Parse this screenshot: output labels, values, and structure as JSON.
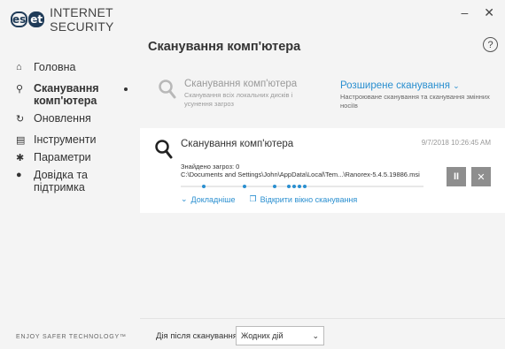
{
  "app": {
    "logo_part1": "es",
    "logo_part2": "et",
    "product_name": "INTERNET SECURITY",
    "tagline": "ENJOY SAFER TECHNOLOGY™"
  },
  "window_controls": {
    "minimize": "–",
    "close": "✕"
  },
  "help": {
    "label": "?"
  },
  "sidebar": {
    "items": [
      {
        "icon": "home-icon",
        "glyph": "⌂",
        "label": "Головна",
        "active": false
      },
      {
        "icon": "search-icon",
        "glyph": "⚲",
        "label": "Сканування комп'ютера",
        "active": true
      },
      {
        "icon": "refresh-icon",
        "glyph": "↻",
        "label": "Оновлення",
        "active": false
      },
      {
        "icon": "toolbox-icon",
        "glyph": "▤",
        "label": "Інструменти",
        "active": false
      },
      {
        "icon": "gear-icon",
        "glyph": "✱",
        "label": "Параметри",
        "active": false
      },
      {
        "icon": "info-icon",
        "glyph": "●",
        "label": "Довідка та підтримка",
        "active": false
      }
    ]
  },
  "main": {
    "title": "Сканування комп'ютера",
    "options": {
      "computer_scan": {
        "title": "Сканування комп'ютера",
        "subtitle": "Сканування всіх локальних дисків і усунення загроз"
      },
      "advanced_scan": {
        "title": "Розширене сканування",
        "subtitle": "Настроюване сканування та сканування змінних носіїв"
      }
    },
    "scan": {
      "title": "Сканування комп'ютера",
      "timestamp": "9/7/2018 10:26:45 AM",
      "found": "Знайдено загроз: 0",
      "path": "C:\\Documents and Settings\\John\\AppData\\Local\\Tem...\\Ranorex-5.4.5.19886.msi",
      "details_label": "Докладніше",
      "open_window_label": "Відкрити вікно сканування",
      "pause_label": "II",
      "stop_label": "✕"
    },
    "after_scan": {
      "label": "Дія після сканування",
      "value": "Жодних дій"
    }
  },
  "colors": {
    "accent": "#2a8fd0",
    "logo": "#1f3b58",
    "button_gray": "#8e8e8e"
  }
}
